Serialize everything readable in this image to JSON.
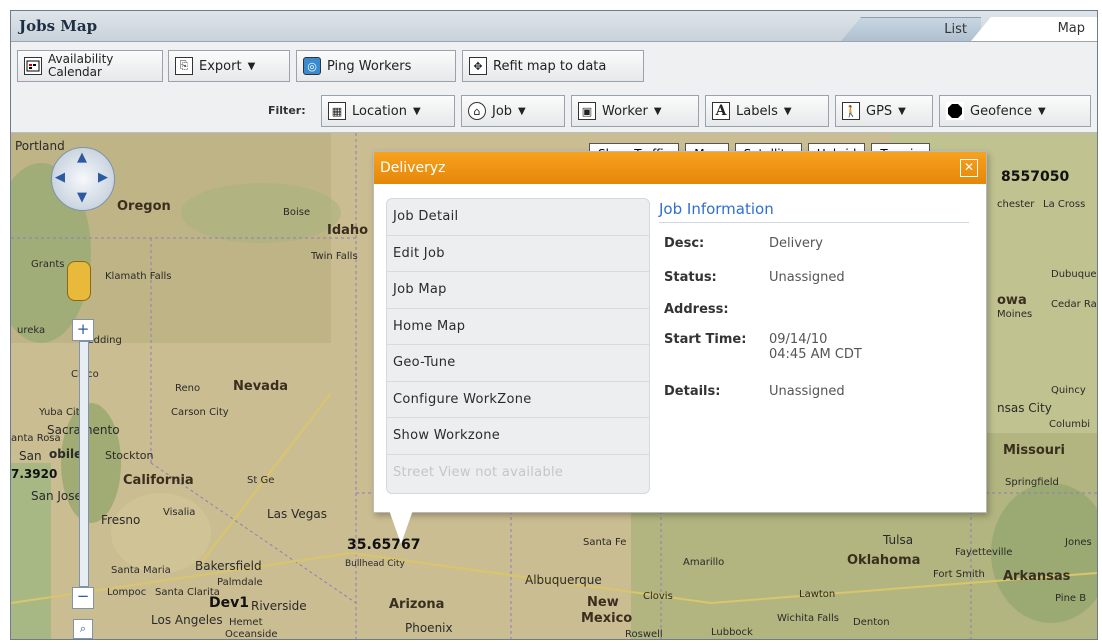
{
  "window": {
    "title": "Jobs Map"
  },
  "tabs": [
    {
      "label": "List"
    },
    {
      "label": "Map"
    }
  ],
  "toolbar": {
    "availability_line1": "Availability",
    "availability_line2": "Calendar",
    "export_label": "Export",
    "ping_label": "Ping Workers",
    "refit_label": "Refit map to data"
  },
  "filter": {
    "label": "Filter:",
    "items": [
      {
        "label": "Location"
      },
      {
        "label": "Job"
      },
      {
        "label": "Worker"
      },
      {
        "label": "Labels"
      },
      {
        "label": "GPS"
      },
      {
        "label": "Geofence"
      }
    ]
  },
  "map_controls": {
    "map_types": [
      {
        "label": "Show Traffic"
      },
      {
        "label": "Map"
      },
      {
        "label": "Satellite"
      },
      {
        "label": "Hybrid"
      },
      {
        "label": "Terrain"
      }
    ]
  },
  "map_labels": {
    "portland": "Portland",
    "oregon": "Oregon",
    "boise": "Boise",
    "idaho": "Idaho",
    "twin_falls": "Twin Falls",
    "grants_pass": "Grants",
    "klamath": "Klamath Falls",
    "redding": "Redding",
    "eureka": "ureka",
    "chico": "Chico",
    "reno": "Reno",
    "nevada": "Nevada",
    "carson": "Carson City",
    "yuba": "Yuba City",
    "sacramento": "Sacramento",
    "santa_rosa": "anta Rosa",
    "san_f": "San",
    "mobile": "obile",
    "stockton": "Stockton",
    "california": "California",
    "san_jose": "San Jose",
    "fresno": "Fresno",
    "visalia": "Visalia",
    "las_vegas": "Las Vegas",
    "st_george": "St Ge",
    "bakersfield": "Bakersfield",
    "santa_maria": "Santa Maria",
    "palmdale": "Palmdale",
    "lompoc": "Lompoc",
    "santa_clarita": "Santa Clarita",
    "riverside": "Riverside",
    "hemet": "Hemet",
    "los_angeles": "Los Angeles",
    "oceanside": "Oceanside",
    "bullhead": "Bullhead City",
    "arizona": "Arizona",
    "phoenix": "Phoenix",
    "santa_fe": "Santa Fe",
    "albuquerque": "Albuquerque",
    "amarillo": "Amarillo",
    "new_mexico_1": "New",
    "new_mexico_2": "Mexico",
    "clovis": "Clovis",
    "roswell": "Roswell",
    "lubbock": "Lubbock",
    "wichita_falls": "Wichita Falls",
    "denton": "Denton",
    "lawton": "Lawton",
    "tulsa": "Tulsa",
    "oklahoma": "Oklahoma",
    "fort_smith": "Fort Smith",
    "fayetteville": "Fayetteville",
    "arkansas": "Arkansas",
    "jones": "Jones",
    "pine_bluff": "Pine B",
    "missouri": "Missouri",
    "springfield": "Springfield",
    "kansas_city": "nsas City",
    "columbia": "Columbi",
    "quincy": "Quincy",
    "iowa": "owa",
    "cedar_rapids": "Cedar Rapids",
    "des_moines": "Moines",
    "dubuque": "Dubuque",
    "la_crosse": "La Cross",
    "rochester": "chester",
    "coord_1": "35.65767",
    "coord_2": "7.3920",
    "coord_3": "8557050",
    "worker_1": "Dev1"
  },
  "popup": {
    "title": "Deliveryz",
    "close_icon": "close-icon",
    "menu": [
      {
        "label": "Job Detail"
      },
      {
        "label": "Edit Job"
      },
      {
        "label": "Job Map"
      },
      {
        "label": "Home Map"
      },
      {
        "label": "Geo-Tune"
      },
      {
        "label": "Configure WorkZone"
      },
      {
        "label": "Show Workzone"
      },
      {
        "label": "Street View not available"
      }
    ],
    "info": {
      "heading": "Job Information",
      "desc_label": "Desc:",
      "desc": "Delivery",
      "status_label": "Status:",
      "status": "Unassigned",
      "address_label": "Address:",
      "address": "",
      "start_label": "Start Time:",
      "start_date": "09/14/10",
      "start_time": "04:45 AM CDT",
      "details_label": "Details:",
      "details": "Unassigned"
    }
  },
  "colors": {
    "popup_header": "#ef9411",
    "info_heading": "#2f6fd0",
    "map_land": "#cbb98d"
  }
}
